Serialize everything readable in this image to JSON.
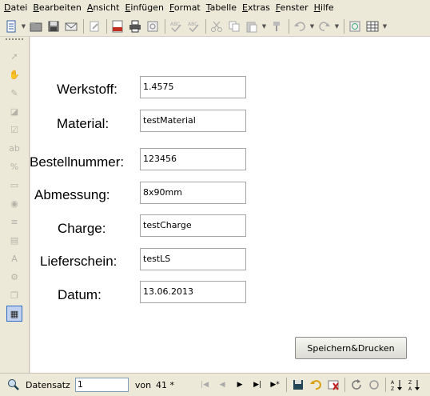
{
  "menu": {
    "items": [
      {
        "acc": "D",
        "rest": "atei"
      },
      {
        "acc": "B",
        "rest": "earbeiten"
      },
      {
        "acc": "A",
        "rest": "nsicht"
      },
      {
        "acc": "E",
        "rest": "infügen"
      },
      {
        "acc": "F",
        "rest": "ormat"
      },
      {
        "acc": "T",
        "rest": "abelle"
      },
      {
        "acc": "E",
        "rest": "xtras"
      },
      {
        "acc": "F",
        "rest": "enster"
      },
      {
        "acc": "H",
        "rest": "ilfe"
      }
    ]
  },
  "form": {
    "fields": [
      {
        "label": "Werkstoff:",
        "value": "1.4575"
      },
      {
        "label": "Material:",
        "value": "testMaterial"
      },
      {
        "label": "Bestellnummer:",
        "value": "123456"
      },
      {
        "label": "Abmessung:",
        "value": "8x90mm"
      },
      {
        "label": "Charge:",
        "value": "testCharge"
      },
      {
        "label": "Lieferschein:",
        "value": "testLS"
      },
      {
        "label": "Datum:",
        "value": "13.06.2013"
      }
    ],
    "save_button_label": "Speichern&Drucken"
  },
  "navigator": {
    "record_label": "Datensatz",
    "record_value": "1",
    "of_label": "von",
    "total": "41 *"
  }
}
